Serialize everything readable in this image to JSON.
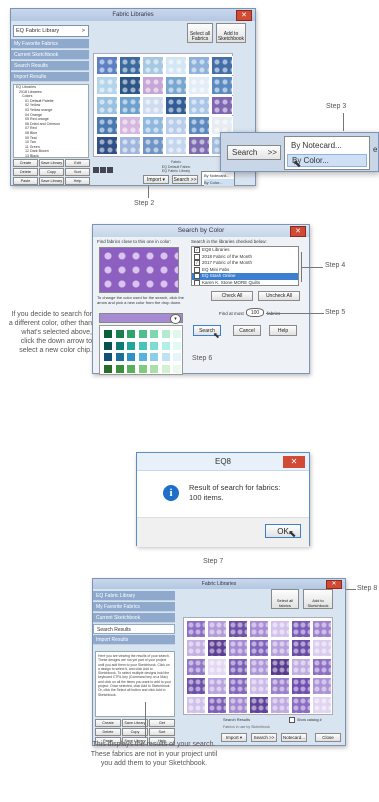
{
  "panel1": {
    "window_title": "Fabric Libraries",
    "library_dropdown": "EQ Fabric Library",
    "nav": [
      "My Favorite Fabrics",
      "Current Sketchbook",
      "Search Results",
      "Import Results"
    ],
    "tree_items": [
      "EQ Libraries",
      "2018 Libraries",
      "Colors",
      "01 Default Palette",
      "02 Yellow",
      "03 Yellow orange",
      "04 Orange",
      "05 Red orange",
      "06 Dried and Crimson",
      "07 Red",
      "08 Blue",
      "09 Teal",
      "10 Tan",
      "11 Green",
      "12 Dark Brown",
      "13 Black",
      "14 Gray"
    ],
    "left_buttons": [
      "Create Library",
      "Save Library",
      "Edit",
      "Delete",
      "Copy",
      "Sort",
      "Paste",
      "Save Library",
      "Help"
    ],
    "top_buttons": [
      "Select all Fabrics",
      "Add to Sketchbook"
    ],
    "status": [
      "Fabric",
      "EQ Default Fabric",
      "EQ Fabric Library"
    ],
    "bottom_buttons": [
      "Import",
      "Search",
      "By Notecard...",
      "By Color..."
    ],
    "callout_search": "Search",
    "callout_arrows": ">>",
    "callout_menu": [
      "By Notecard...",
      "By Color..."
    ],
    "callout_partial": "e",
    "step2": "Step 2",
    "step3": "Step 3"
  },
  "panel2": {
    "title": "Search by Color",
    "find_label": "Find fabrics close to this one in color:",
    "search_in_label": "Search in the libraries checked below:",
    "libraries": [
      {
        "name": "EQ8 Libraries",
        "checked": true
      },
      {
        "name": "2018 Fabric of the Month",
        "checked": false
      },
      {
        "name": "2017 Fabric of the Month",
        "checked": true
      },
      {
        "name": "EQ Mini Fabs",
        "checked": false
      },
      {
        "name": "EQ Stash Online",
        "checked": true
      },
      {
        "name": "Karen K. Stone MORE Quilts",
        "checked": false
      }
    ],
    "change_color_text": "To change the color used for the search, click the arrow and pick a new color from the drop down.",
    "check_all": "Check All",
    "uncheck_all": "Uncheck All",
    "find_at_most": "Find at most",
    "find_count": "100",
    "fabrics_label": "fabrics",
    "search_btn": "Search",
    "cancel_btn": "Cancel",
    "help_btn": "Help",
    "step4": "Step 4",
    "step5": "Step 5",
    "step6": "Step 6",
    "side_note": "If you decide to search for a different color, other than what's selected above, click the down arrow to select a new color chip."
  },
  "panel3": {
    "title": "EQ8",
    "message": "Result of search for fabrics:\n100 items.",
    "ok": "OK",
    "step7": "Step 7"
  },
  "panel4": {
    "window_title": "Fabric Libraries",
    "nav": [
      "EQ Fabric Library",
      "My Favorite Fabrics",
      "Current Sketchbook",
      "Search Results",
      "Import Results"
    ],
    "info_text": "Here you are viewing the results of your search. These designs are not yet part of your project until you add them to your Sketchbook. Click on a design to select it, and click Add to Sketchbook. To select multiple designs hold the keyboard CTRL key (Command key on a Mac) and click on all the items you want to add to your project. Once selected, click Add to Sketchbook. Or, click the Select all button and click Add to Sketchbook.",
    "left_buttons": [
      "Create Library",
      "Save Library",
      "Get",
      "Delete",
      "Copy",
      "Sort",
      "Paste",
      "Save Library",
      "Help"
    ],
    "top_buttons": [
      "Select all fabrics",
      "Add to Sketchbook"
    ],
    "status": "Search Results",
    "status2": "Fabrics in use by Sketchbook",
    "show_catalog": "Show catalog #",
    "bottom_buttons": [
      "Import",
      "Search",
      "Notecard...",
      "Close"
    ],
    "step8": "Step 8",
    "caption": "This displays the results of your search. These fabrics are not in your project until you add them to your Sketchbook."
  }
}
